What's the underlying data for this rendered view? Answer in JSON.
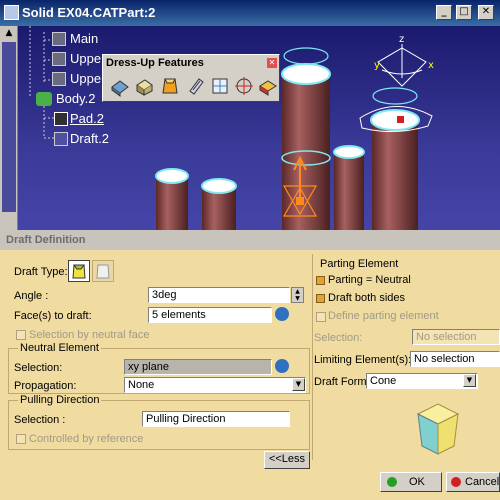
{
  "window": {
    "title": "Solid EX04.CATPart:2",
    "minimize": "_",
    "maximize": "□",
    "close": "✕"
  },
  "tree": {
    "items": [
      {
        "label": "Main"
      },
      {
        "label": "Upper"
      },
      {
        "label": "Upper Surface"
      },
      {
        "label": "Body.2"
      },
      {
        "label": "Pad.2"
      },
      {
        "label": "Draft.2"
      }
    ]
  },
  "toolbar": {
    "title": "Dress-Up Features",
    "close": "✕",
    "tools": [
      "fillet-icon",
      "chamfer-icon",
      "draft-icon",
      "shell-icon",
      "thickness-icon",
      "thread-icon",
      "remove-face-icon"
    ]
  },
  "axes": {
    "z": "z",
    "y": "y",
    "x": "x"
  },
  "dialog": {
    "title": "Draft Definition",
    "draft_type_label": "Draft Type:",
    "angle_label": "Angle :",
    "angle_value": "3deg",
    "faces_label": "Face(s) to draft:",
    "faces_value": "5 elements",
    "selection_neutral_face": "Selection by neutral face",
    "neutral": {
      "title": "Neutral Element",
      "selection_label": "Selection:",
      "selection_value": "xy plane",
      "propagation_label": "Propagation:",
      "propagation_value": "None"
    },
    "pulling": {
      "title": "Pulling Direction",
      "selection_label": "Selection :",
      "selection_value": "Pulling Direction",
      "controlled": "Controlled by reference"
    },
    "less_button": "<<Less",
    "parting": {
      "title": "Parting Element",
      "parting_neutral": "Parting = Neutral",
      "draft_both": "Draft both sides",
      "define_parting": "Define parting element",
      "selection_label": "Selection:",
      "selection_value": "No selection"
    },
    "limiting_label": "Limiting Element(s):",
    "limiting_value": "No selection",
    "draft_form_label": "Draft Form:",
    "draft_form_value": "Cone",
    "ok": "OK",
    "cancel": "Cancel"
  },
  "colors": {
    "cylinder": "#8c4040",
    "highlight": "#80e8f0",
    "dialog_bg": "#f0dca0"
  }
}
